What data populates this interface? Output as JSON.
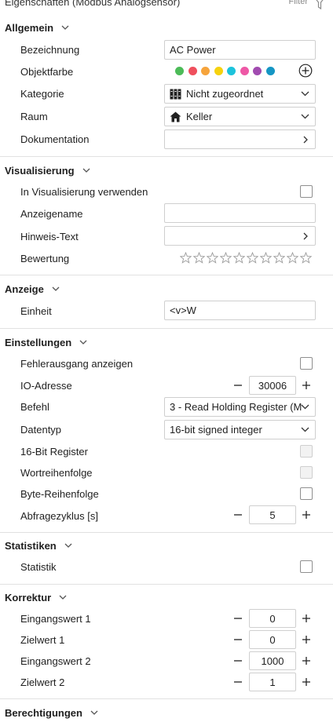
{
  "header": {
    "title": "Eigenschaften (Modbus Analogsensor)",
    "filter_label": "Filter"
  },
  "sections": {
    "allgemein": {
      "title": "Allgemein",
      "bezeichnung_label": "Bezeichnung",
      "bezeichnung_value": "AC Power",
      "objektfarbe_label": "Objektfarbe",
      "colors": [
        "#4cbb58",
        "#ef4f5d",
        "#f6a43c",
        "#f6d20e",
        "#1cc3dc",
        "#ee58a6",
        "#a14bb0",
        "#1596c4"
      ],
      "kategorie_label": "Kategorie",
      "kategorie_value": "Nicht zugeordnet",
      "raum_label": "Raum",
      "raum_value": "Keller",
      "dokumentation_label": "Dokumentation"
    },
    "visualisierung": {
      "title": "Visualisierung",
      "verwenden_label": "In Visualisierung verwenden",
      "anzeigename_label": "Anzeigename",
      "hinweis_label": "Hinweis-Text",
      "bewertung_label": "Bewertung",
      "rating_max": 10,
      "rating_value": 0
    },
    "anzeige": {
      "title": "Anzeige",
      "einheit_label": "Einheit",
      "einheit_value": "<v>W"
    },
    "einstellungen": {
      "title": "Einstellungen",
      "fehlerausgang_label": "Fehlerausgang anzeigen",
      "io_adresse_label": "IO-Adresse",
      "io_adresse_value": "30006",
      "befehl_label": "Befehl",
      "befehl_value": "3 - Read Holding Register (M",
      "datentyp_label": "Datentyp",
      "datentyp_value": "16-bit signed integer",
      "register16_label": "16-Bit Register",
      "wortreihenfolge_label": "Wortreihenfolge",
      "bytereihenfolge_label": "Byte-Reihenfolge",
      "abfragezyklus_label": "Abfragezyklus [s]",
      "abfragezyklus_value": "5"
    },
    "statistiken": {
      "title": "Statistiken",
      "statistik_label": "Statistik"
    },
    "korrektur": {
      "title": "Korrektur",
      "eingangswert1_label": "Eingangswert 1",
      "eingangswert1_value": "0",
      "zielwert1_label": "Zielwert 1",
      "zielwert1_value": "0",
      "eingangswert2_label": "Eingangswert 2",
      "eingangswert2_value": "1000",
      "zielwert2_label": "Zielwert 2",
      "zielwert2_value": "1"
    },
    "berechtigungen": {
      "title": "Berechtigungen"
    }
  }
}
